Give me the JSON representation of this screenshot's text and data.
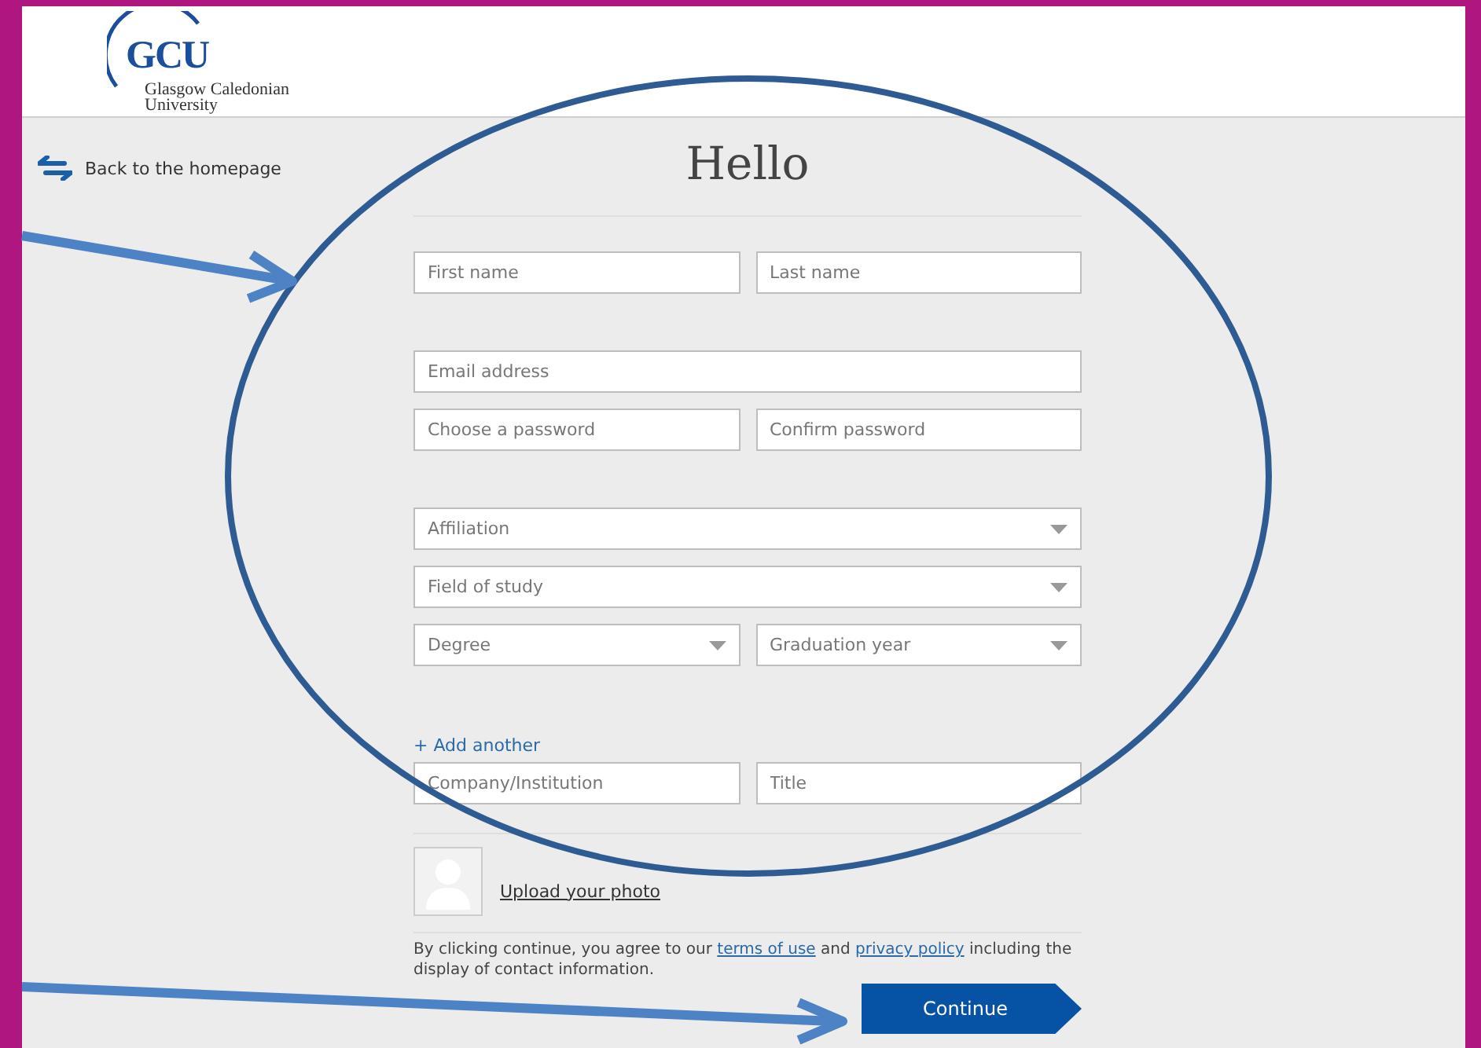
{
  "logo": {
    "mark": "GCU",
    "name_line_1": "Glasgow Caledonian",
    "name_line_2": "University"
  },
  "back_link": {
    "label": "Back to the homepage"
  },
  "heading": "Hello",
  "field_groups": [
    {
      "fields": [
        {
          "kind": "input",
          "placeholder": "First name"
        },
        {
          "kind": "input",
          "placeholder": "Last name"
        }
      ]
    },
    {
      "fields": [
        {
          "kind": "input",
          "placeholder": "Email address"
        }
      ]
    },
    {
      "fields": [
        {
          "kind": "input",
          "placeholder": "Choose a password"
        },
        {
          "kind": "input",
          "placeholder": "Confirm password"
        }
      ]
    },
    {
      "fields": [
        {
          "kind": "select",
          "placeholder": "Affiliation"
        }
      ]
    },
    {
      "fields": [
        {
          "kind": "select",
          "placeholder": "Field of study"
        }
      ]
    },
    {
      "fields": [
        {
          "kind": "select",
          "placeholder": "Degree"
        },
        {
          "kind": "select",
          "placeholder": "Graduation year"
        }
      ]
    }
  ],
  "add_another": "+ Add another",
  "work_fields": [
    {
      "kind": "input",
      "placeholder": "Company/Institution"
    },
    {
      "kind": "input",
      "placeholder": "Title"
    }
  ],
  "photo": {
    "link": "Upload your photo"
  },
  "terms": {
    "before": "By clicking continue, you agree to our",
    "link_1": "terms of use",
    "middle": "and",
    "link_2": "privacy policy",
    "after": "including the display of contact information."
  },
  "continue_button": "Continue"
}
